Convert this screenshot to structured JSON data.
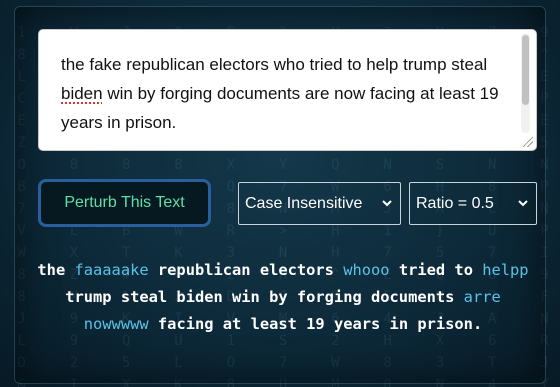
{
  "input": {
    "segments": [
      {
        "text": "the fake republican electors who tried to help trump steal ",
        "misspelled": false
      },
      {
        "text": "biden",
        "misspelled": true
      },
      {
        "text": " win by forging documents are now facing at least 19 years in prison.",
        "misspelled": false
      }
    ]
  },
  "controls": {
    "perturb_label": "Perturb This Text",
    "case_select": "Case Insensitive",
    "ratio_select": "Ratio = 0.5"
  },
  "output": {
    "tokens": [
      {
        "text": "the ",
        "changed": false
      },
      {
        "text": "faaaaake",
        "changed": true
      },
      {
        "text": " republican electors ",
        "changed": false
      },
      {
        "text": "whooo",
        "changed": true
      },
      {
        "text": " tried to ",
        "changed": false
      },
      {
        "text": "helpp",
        "changed": true
      },
      {
        "text": " trump steal biden win by forging documents ",
        "changed": false
      },
      {
        "text": "arre",
        "changed": true
      },
      {
        "text": " ",
        "changed": false
      },
      {
        "text": "nowwwww",
        "changed": true
      },
      {
        "text": " facing at least 19 years in prison.",
        "changed": false
      }
    ]
  },
  "colors": {
    "button_text": "#5fe0a6",
    "highlight": "#5bc3e8"
  },
  "icons": {
    "select_arrow": "chevron-down-icon"
  }
}
